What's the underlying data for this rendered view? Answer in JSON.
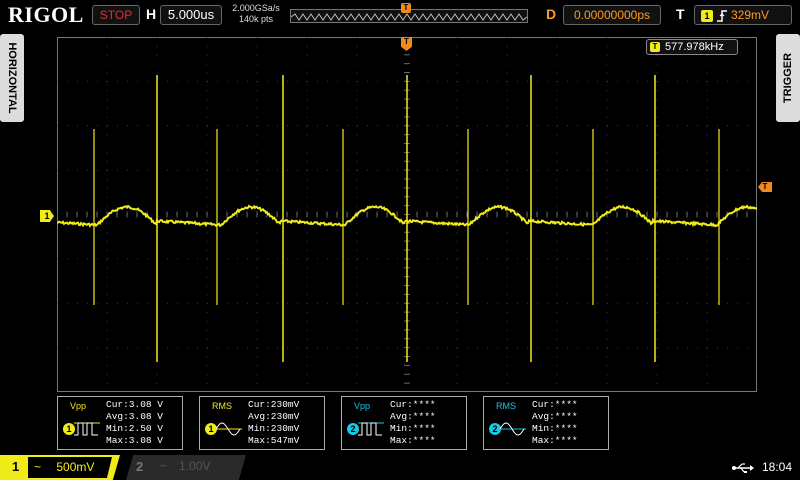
{
  "topbar": {
    "brand": "RIGOL",
    "run_state": "STOP",
    "h_label": "H",
    "timebase": "5.000us",
    "sample_rate": "2.000GSa/s",
    "memory_depth": "140k pts",
    "trigger_pos_marker": "T",
    "delay_label": "D",
    "delay_value": "0.00000000ps",
    "trigger_label": "T",
    "trigger_channel": "1",
    "trigger_level": "329mV"
  },
  "side_tabs": {
    "left": "HORIZONTAL",
    "right": "TRIGGER"
  },
  "screen": {
    "frequency_counter": "577.978kHz",
    "freq_badge": "T",
    "ch1_marker": "1",
    "trig_level_marker": "T"
  },
  "measurements": [
    {
      "name": "Vpp",
      "channel": "1",
      "channel_color": "#f0ec1a",
      "lines": [
        "Cur:3.08 V",
        "Avg:3.08 V",
        "Min:2.50 V",
        "Max:3.08 V"
      ],
      "icon": "pulse-icon"
    },
    {
      "name": "RMS",
      "channel": "1",
      "channel_color": "#f0ec1a",
      "lines": [
        "Cur:230mV",
        "Avg:230mV",
        "Min:230mV",
        "Max:547mV"
      ],
      "icon": "sine-icon"
    },
    {
      "name": "Vpp",
      "channel": "2",
      "channel_color": "#19c8e6",
      "lines": [
        "Cur:****",
        "Avg:****",
        "Min:****",
        "Max:****"
      ],
      "icon": "pulse-icon"
    },
    {
      "name": "RMS",
      "channel": "2",
      "channel_color": "#19c8e6",
      "lines": [
        "Cur:****",
        "Avg:****",
        "Min:****",
        "Max:****"
      ],
      "icon": "sine-icon"
    }
  ],
  "bottombar": {
    "ch1": {
      "number": "1",
      "coupling": "~",
      "scale": "500mV"
    },
    "ch2": {
      "number": "2",
      "coupling": "~",
      "scale": "1.00V"
    },
    "time": "18:04"
  },
  "colors": {
    "ch1": "#f0ec1a",
    "ch2": "#19c8e6",
    "trigger": "#f08a1a",
    "grid": "#3a3a3a"
  }
}
